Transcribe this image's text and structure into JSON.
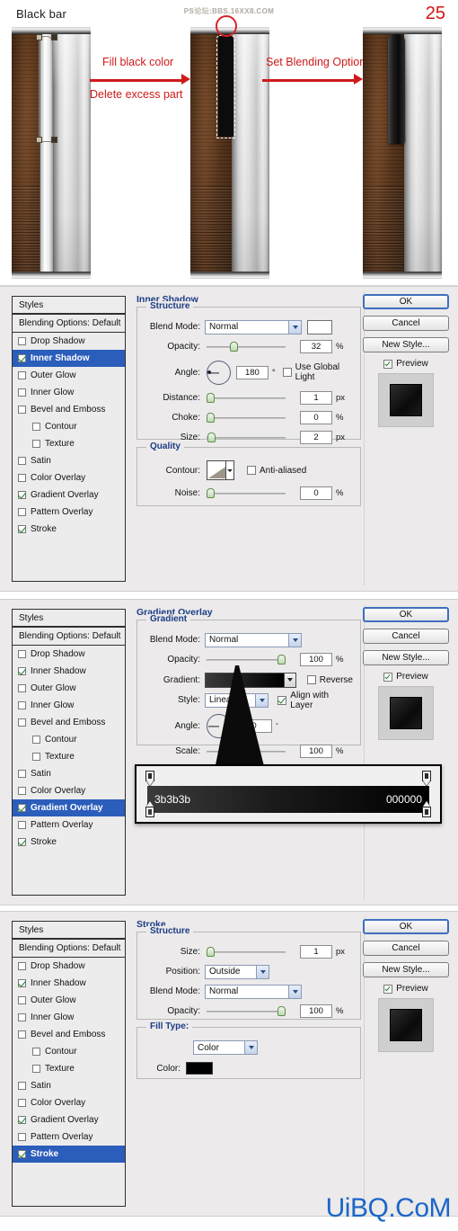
{
  "tutorial": {
    "title": "Black bar",
    "step_number": "25",
    "watermark_top": "PS论坛:BBS.16XX8.COM",
    "arrow1_label_top": "Fill black color",
    "arrow1_label_bottom": "Delete excess part",
    "arrow2_label": "Set Blending Options"
  },
  "watermark_bottom": "UiBQ.CoM",
  "styles_list": {
    "header": "Styles",
    "blending_options": "Blending Options: Default",
    "items": [
      {
        "label": "Drop Shadow",
        "checked": false,
        "indent": false
      },
      {
        "label": "Inner Shadow",
        "checked": true,
        "indent": false
      },
      {
        "label": "Outer Glow",
        "checked": false,
        "indent": false
      },
      {
        "label": "Inner Glow",
        "checked": false,
        "indent": false
      },
      {
        "label": "Bevel and Emboss",
        "checked": false,
        "indent": false
      },
      {
        "label": "Contour",
        "checked": false,
        "indent": true
      },
      {
        "label": "Texture",
        "checked": false,
        "indent": true
      },
      {
        "label": "Satin",
        "checked": false,
        "indent": false
      },
      {
        "label": "Color Overlay",
        "checked": false,
        "indent": false
      },
      {
        "label": "Gradient Overlay",
        "checked": true,
        "indent": false
      },
      {
        "label": "Pattern Overlay",
        "checked": false,
        "indent": false
      },
      {
        "label": "Stroke",
        "checked": true,
        "indent": false
      }
    ]
  },
  "buttons": {
    "ok": "OK",
    "cancel": "Cancel",
    "new_style": "New Style...",
    "preview": "Preview"
  },
  "dialog_inner_shadow": {
    "title": "Inner Shadow",
    "selected_style": "Inner Shadow",
    "structure_legend": "Structure",
    "quality_legend": "Quality",
    "blend_mode_label": "Blend Mode:",
    "blend_mode_value": "Normal",
    "opacity_label": "Opacity:",
    "opacity_value": "32",
    "opacity_unit": "%",
    "angle_label": "Angle:",
    "angle_value": "180",
    "angle_unit": "°",
    "use_global_light": "Use Global Light",
    "use_global_light_checked": false,
    "distance_label": "Distance:",
    "distance_value": "1",
    "distance_unit": "px",
    "choke_label": "Choke:",
    "choke_value": "0",
    "choke_unit": "%",
    "size_label": "Size:",
    "size_value": "2",
    "size_unit": "px",
    "contour_label": "Contour:",
    "anti_aliased": "Anti-aliased",
    "anti_aliased_checked": false,
    "noise_label": "Noise:",
    "noise_value": "0",
    "noise_unit": "%"
  },
  "dialog_gradient_overlay": {
    "title": "Gradient Overlay",
    "selected_style": "Gradient Overlay",
    "gradient_legend": "Gradient",
    "blend_mode_label": "Blend Mode:",
    "blend_mode_value": "Normal",
    "opacity_label": "Opacity:",
    "opacity_value": "100",
    "opacity_unit": "%",
    "gradient_label": "Gradient:",
    "reverse_label": "Reverse",
    "reverse_checked": false,
    "style_label": "Style:",
    "style_value": "Linear",
    "align_with_layer": "Align with Layer",
    "align_with_layer_checked": true,
    "angle_label": "Angle:",
    "angle_value": "0",
    "angle_unit": "°",
    "scale_label": "Scale:",
    "scale_value": "100",
    "scale_unit": "%",
    "gradient_start_hex": "3b3b3b",
    "gradient_end_hex": "000000"
  },
  "dialog_stroke": {
    "title": "Stroke",
    "selected_style": "Stroke",
    "structure_legend": "Structure",
    "size_label": "Size:",
    "size_value": "1",
    "size_unit": "px",
    "position_label": "Position:",
    "position_value": "Outside",
    "blend_mode_label": "Blend Mode:",
    "blend_mode_value": "Normal",
    "opacity_label": "Opacity:",
    "opacity_value": "100",
    "opacity_unit": "%",
    "fill_type_label": "Fill Type:",
    "fill_type_value": "Color",
    "color_label": "Color:",
    "color_value": "#000000"
  },
  "colors": {
    "accent_blue": "#1b3c86",
    "selection_blue": "#2b5dbb",
    "red": "#cf1a1a",
    "watermark_blue": "#1b66c9"
  }
}
